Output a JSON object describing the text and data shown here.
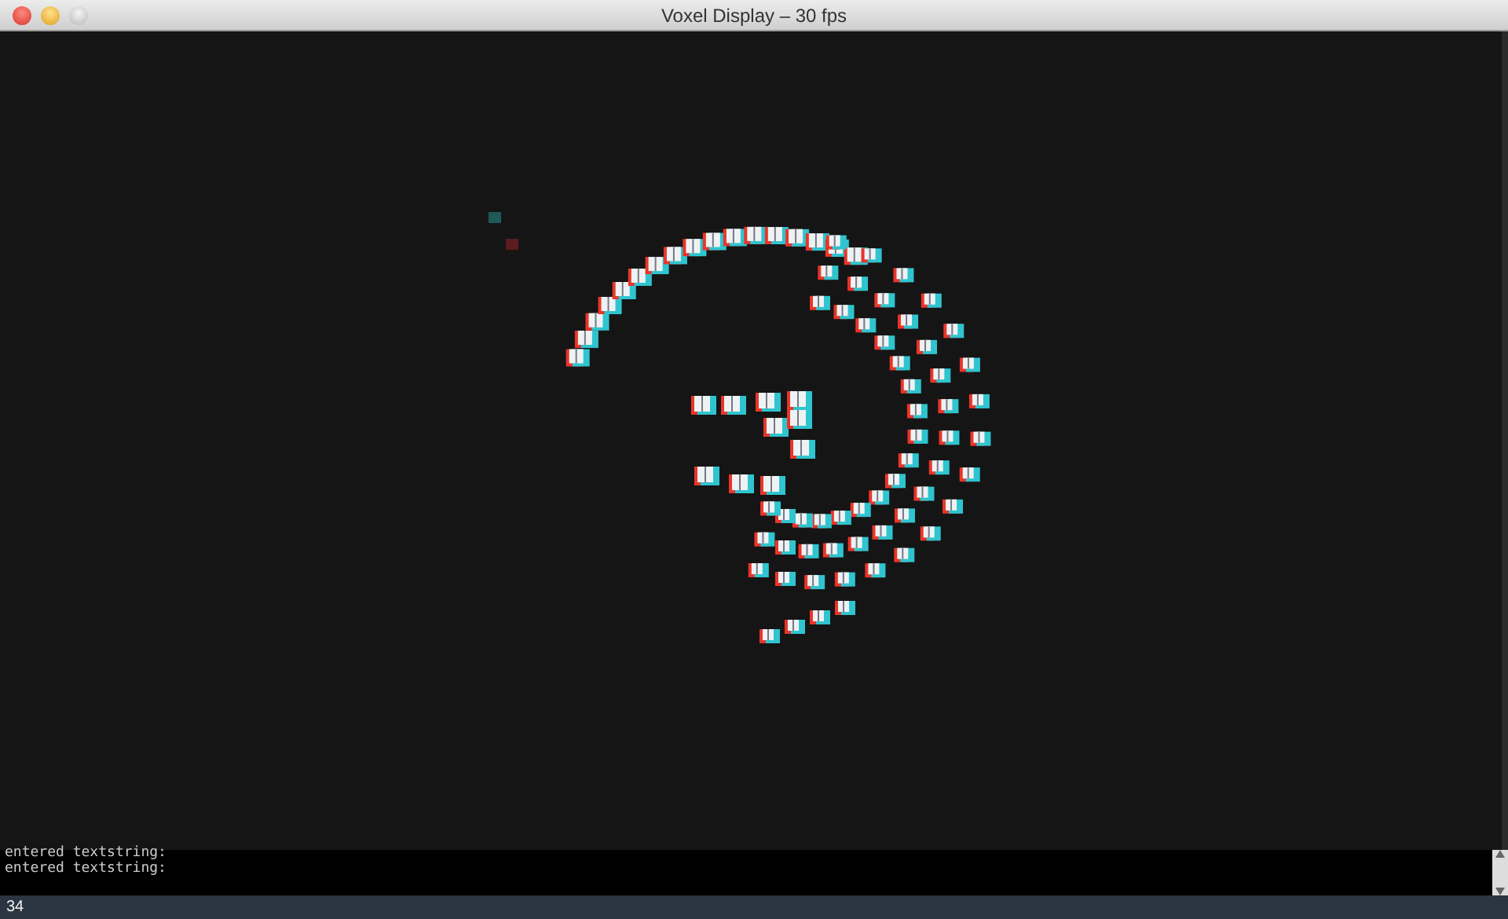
{
  "window": {
    "title": "Voxel Display – 30 fps"
  },
  "console": {
    "lines": [
      "entered textstring:",
      "entered textstring:"
    ]
  },
  "status_bar": {
    "text": "34"
  }
}
